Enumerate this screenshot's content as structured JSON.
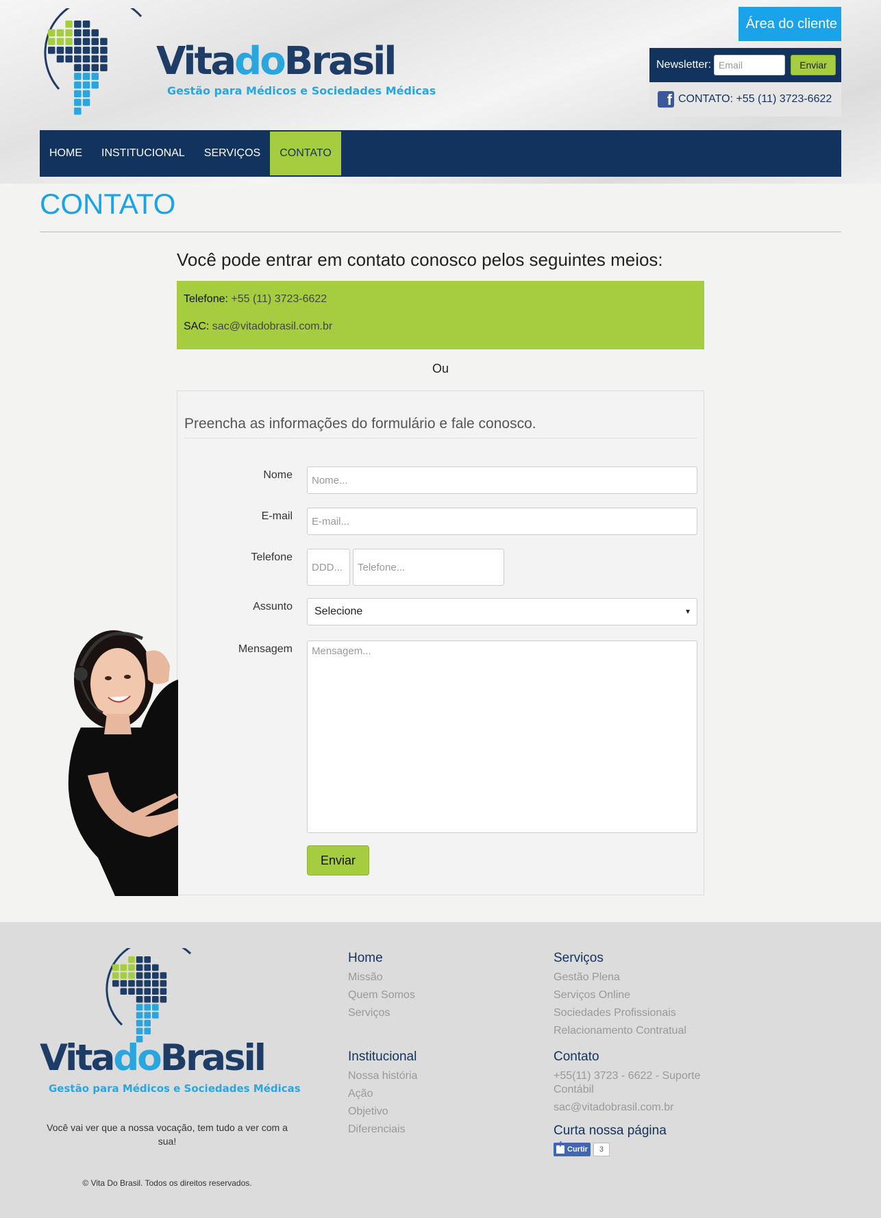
{
  "brand": {
    "word_vita": "Vita",
    "word_do": "do",
    "word_brasil": "Brasil",
    "tagline": "Gestão para Médicos e Sociedades Médicas"
  },
  "header": {
    "client_area_label": "Área do cliente",
    "newsletter_label": "Newsletter:",
    "newsletter_placeholder": "Email",
    "newsletter_button": "Enviar",
    "contact_text": "CONTATO: +55 (11) 3723-6622"
  },
  "nav": {
    "items": [
      {
        "label": "HOME"
      },
      {
        "label": "INSTITUCIONAL"
      },
      {
        "label": "SERVIÇOS"
      },
      {
        "label": "CONTATO"
      }
    ]
  },
  "main": {
    "page_title": "CONTATO",
    "intro": "Você pode entrar em contato conosco pelos seguintes meios:",
    "phone_label": "Telefone:",
    "phone_value": "+55 (11) 3723-6622",
    "sac_label": "SAC:",
    "sac_value": "sac@vitadobrasil.com.br",
    "or_text": "Ou"
  },
  "form": {
    "heading": "Preencha as informações do formulário e fale conosco.",
    "name_label": "Nome",
    "name_placeholder": "Nome...",
    "email_label": "E-mail",
    "email_placeholder": "E-mail...",
    "phone_label": "Telefone",
    "ddd_placeholder": "DDD...",
    "phone_placeholder": "Telefone...",
    "subject_label": "Assunto",
    "subject_selected": "Selecione",
    "message_label": "Mensagem",
    "message_placeholder": "Mensagem...",
    "submit_label": "Enviar"
  },
  "footer": {
    "slogan": "Você vai ver que a nossa vocação, tem tudo a ver com a sua!",
    "copyright": "© Vita Do Brasil. Todos os direitos reservados.",
    "col_home": {
      "title": "Home",
      "links": [
        "Missão",
        "Quem Somos",
        "Serviços"
      ]
    },
    "col_institucional": {
      "title": "Institucional",
      "links": [
        "Nossa história",
        "Ação",
        "Objetivo",
        "Diferenciais"
      ]
    },
    "col_servicos": {
      "title": "Serviços",
      "links": [
        "Gestão Plena",
        "Serviços Online",
        "Sociedades Profissionais",
        "Relacionamento Contratual"
      ]
    },
    "col_contato": {
      "title": "Contato",
      "phone": "+55(11) 3723 - 6622 - Suporte Contábil",
      "email": "sac@vitadobrasil.com.br"
    },
    "like_title": "Curta nossa página",
    "like_button": "Curtir",
    "like_count": "3"
  },
  "colors": {
    "navy": "#11335e",
    "green": "#a6cd3f",
    "blue": "#1aa3e8",
    "brand_dark": "#1e3d66"
  },
  "icons": [
    "facebook-icon",
    "select-caret-icon",
    "globe-logo-icon"
  ]
}
